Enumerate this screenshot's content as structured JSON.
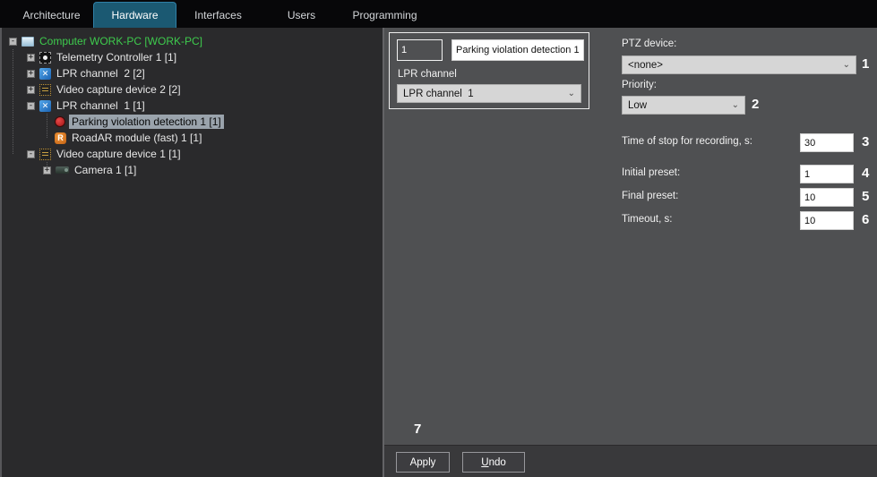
{
  "tabs": [
    {
      "label": "Architecture",
      "active": false
    },
    {
      "label": "Hardware",
      "active": true
    },
    {
      "label": "Interfaces",
      "active": false
    },
    {
      "label": "Users",
      "active": false
    },
    {
      "label": "Programming",
      "active": false
    }
  ],
  "tree": {
    "collapse_glyph": "-",
    "expand_glyph": "+",
    "items": [
      {
        "label": "Computer WORK-PC [WORK-PC]",
        "icon": "computer",
        "state": "collapse"
      },
      {
        "label": "Telemetry Controller 1 [1]",
        "icon": "telemetry",
        "state": "expand"
      },
      {
        "label": "LPR channel  2 [2]",
        "icon": "lpr",
        "state": "expand"
      },
      {
        "label": "Video capture device 2 [2]",
        "icon": "video-capture",
        "state": "expand"
      },
      {
        "label": "LPR channel  1 [1]",
        "icon": "lpr",
        "state": "collapse"
      },
      {
        "label": "Parking violation detection 1 [1]",
        "icon": "parking-violation",
        "state": "none",
        "selected": true
      },
      {
        "label": "RoadAR module (fast) 1 [1]",
        "icon": "roadar",
        "state": "none"
      },
      {
        "label": "Video capture device 1 [1]",
        "icon": "video-capture",
        "state": "collapse"
      },
      {
        "label": "Camera 1 [1]",
        "icon": "camera",
        "state": "expand"
      }
    ],
    "roadar_glyph": "R",
    "lpr_glyph": "✕"
  },
  "editor": {
    "id_value": "1",
    "name_value": "Parking violation detection 1",
    "channel_label": "LPR channel",
    "channel_value": "LPR channel  1"
  },
  "settings": {
    "ptz_label": "PTZ device:",
    "ptz_value": "<none>",
    "ptz_step": "1",
    "priority_label": "Priority:",
    "priority_value": "Low",
    "priority_step": "2",
    "fields": [
      {
        "label": "Time of stop for recording, s:",
        "value": "30",
        "step": "3"
      },
      {
        "label": "Initial preset:",
        "value": "1",
        "step": "4"
      },
      {
        "label": "Final preset:",
        "value": "10",
        "step": "5"
      },
      {
        "label": "Timeout, s:",
        "value": "10",
        "step": "6"
      }
    ],
    "chevron_glyph": "⌄"
  },
  "actions": {
    "apply_label": "Apply",
    "undo_key": "U",
    "undo_rest": "ndo",
    "apply_step": "7"
  }
}
